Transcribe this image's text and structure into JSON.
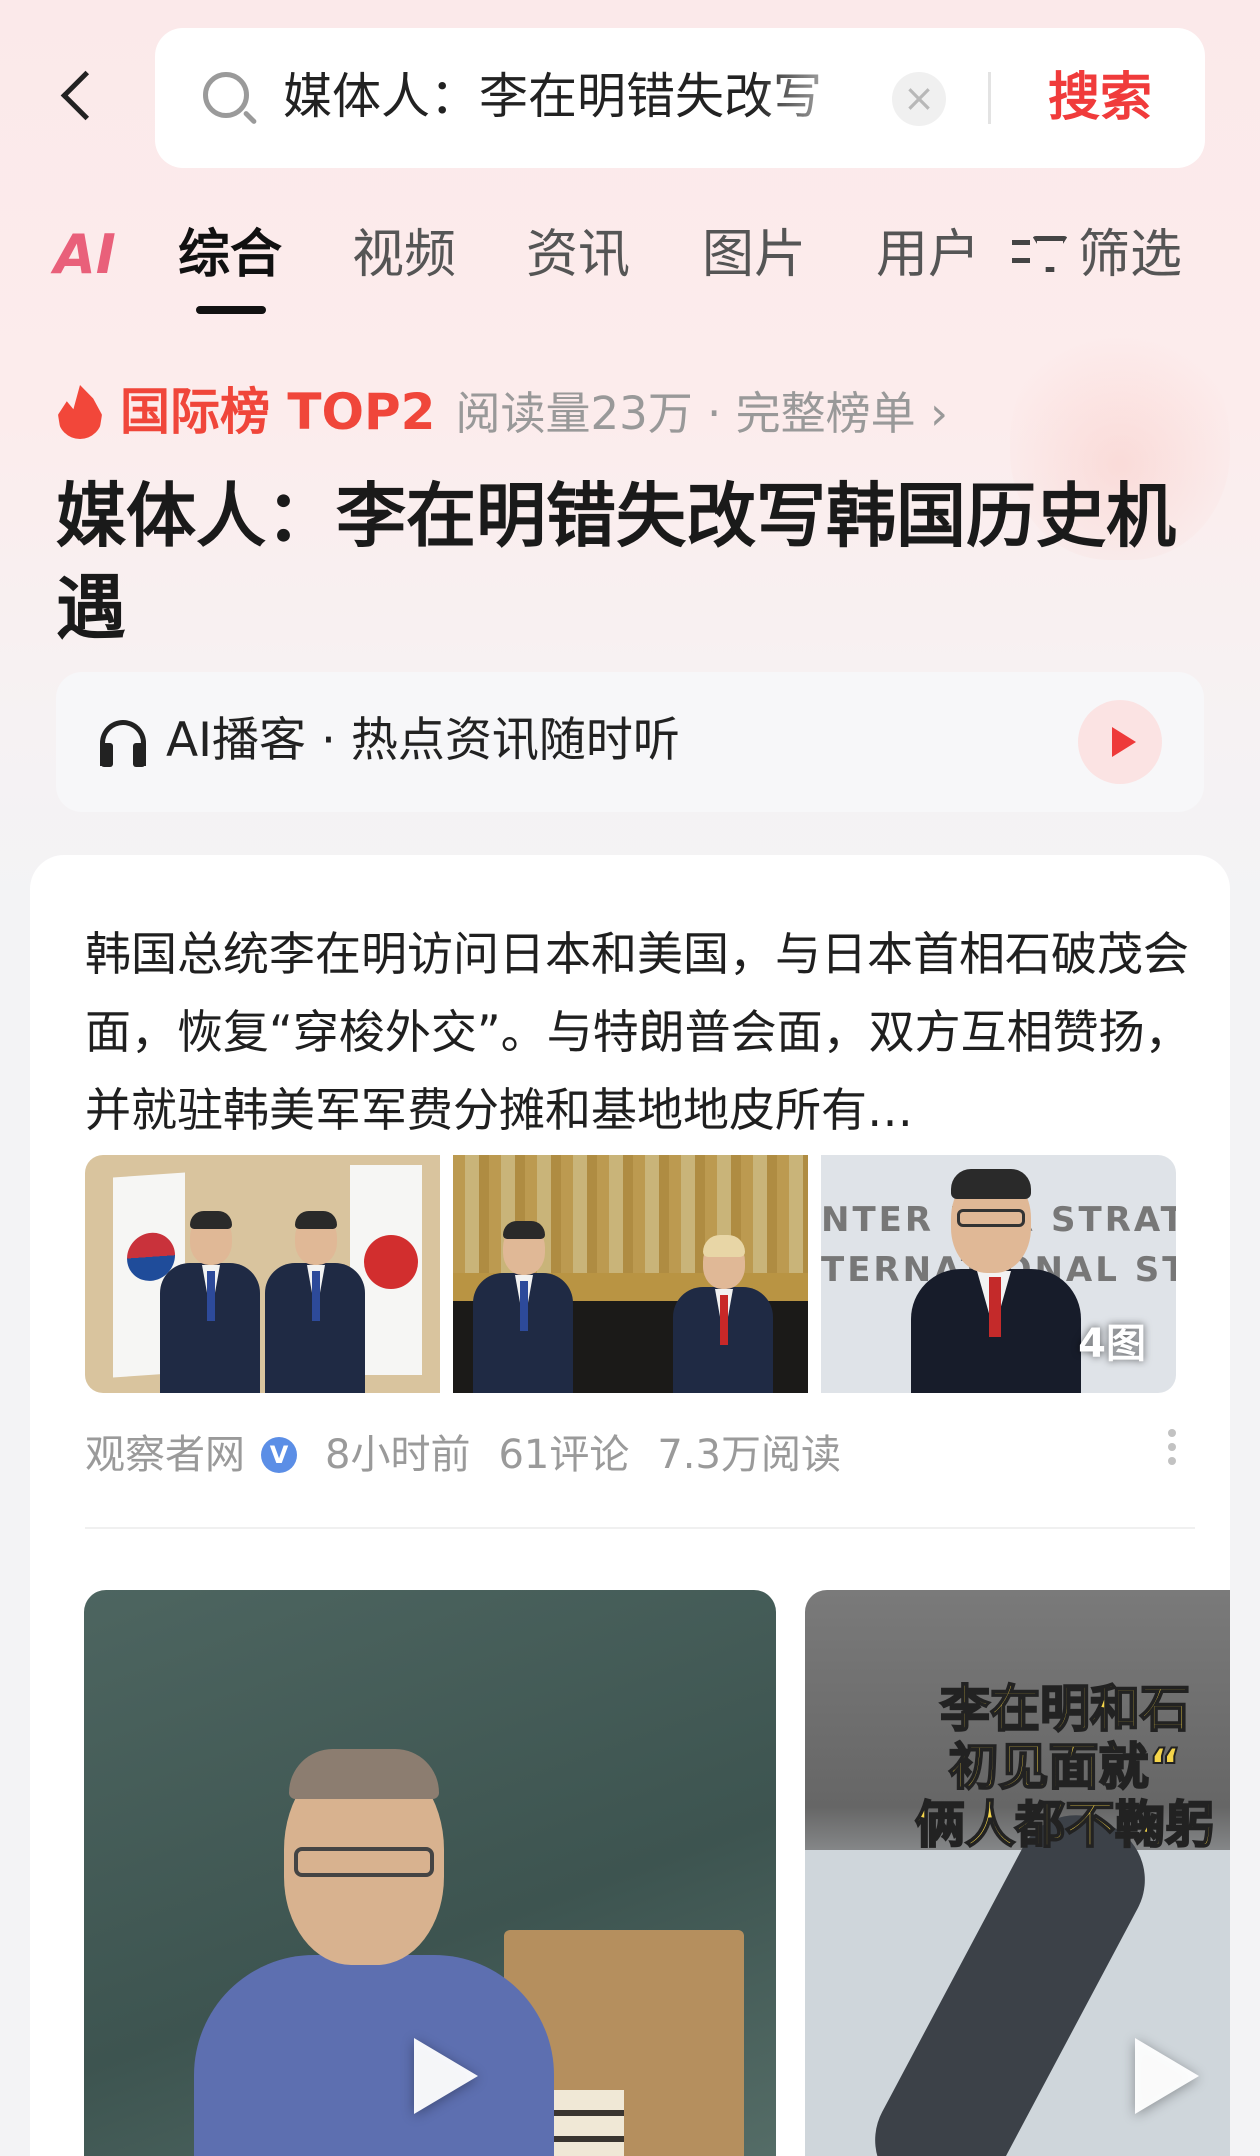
{
  "search": {
    "query": "媒体人：李在明错失改写",
    "clear_symbol": "×",
    "submit_label": "搜索"
  },
  "tabs": [
    {
      "label": "AI"
    },
    {
      "label": "综合"
    },
    {
      "label": "视频"
    },
    {
      "label": "资讯"
    },
    {
      "label": "图片"
    },
    {
      "label": "用户"
    },
    {
      "label": "筛选"
    }
  ],
  "active_tab": "综合",
  "rank": {
    "label": "国际榜 TOP2",
    "meta": "阅读量23万 · 完整榜单 ›"
  },
  "headline": "媒体人：李在明错失改写韩国历史机遇",
  "podcast": {
    "text": "AI播客 · 热点资讯随时听"
  },
  "article": {
    "summary": "韩国总统李在明访问日本和美国，与日本首相石破茂会面，恢复“穿梭外交”。与特朗普会面，双方互相赞扬，并就驻韩美军军费分摊和基地地皮所有…",
    "image_count": "4图",
    "thumb3_banner": "NTER FOR STRATEGIC\nTERNATIONAL STUDIES",
    "source": "观察者网",
    "verified_mark": "V",
    "time": "8小时前",
    "comments": "61评论",
    "reads": "7.3万阅读"
  },
  "videos": [
    {
      "caption": ""
    },
    {
      "caption": "李在明和石\n初见面就“\n俩人都不鞠躬"
    }
  ],
  "colors": {
    "accent": "#f03b3b",
    "ai_tab": "#e9607a",
    "verified": "#5b8ee6"
  }
}
